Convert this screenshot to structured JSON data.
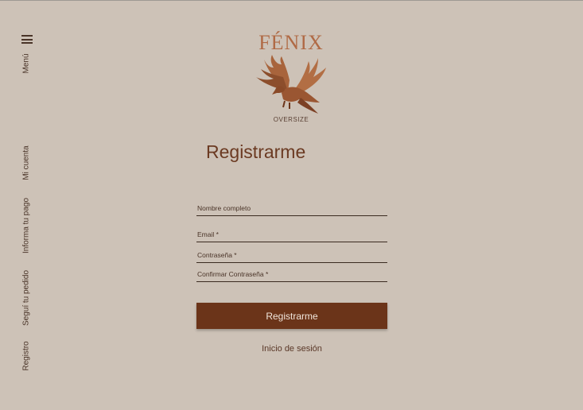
{
  "sidebar": {
    "menu_label": "Menú",
    "items": [
      {
        "label": "Mi cuenta"
      },
      {
        "label": "Informa tu pago"
      },
      {
        "label": "Seguí tu pedido"
      },
      {
        "label": "Registro"
      }
    ]
  },
  "logo": {
    "brand": "FÉNIX",
    "subtitle": "OVERSIZE"
  },
  "form": {
    "title": "Registrarme",
    "fields": [
      {
        "label": "Nombre completo"
      },
      {
        "label": "Email *"
      },
      {
        "label": "Contraseña *"
      },
      {
        "label": "Confirmar Contraseña *"
      }
    ],
    "submit_label": "Registrarme",
    "login_link": "Inicio de sesión"
  },
  "colors": {
    "background": "#cdc2b7",
    "accent": "#6b3419",
    "brand": "#b06a45"
  }
}
